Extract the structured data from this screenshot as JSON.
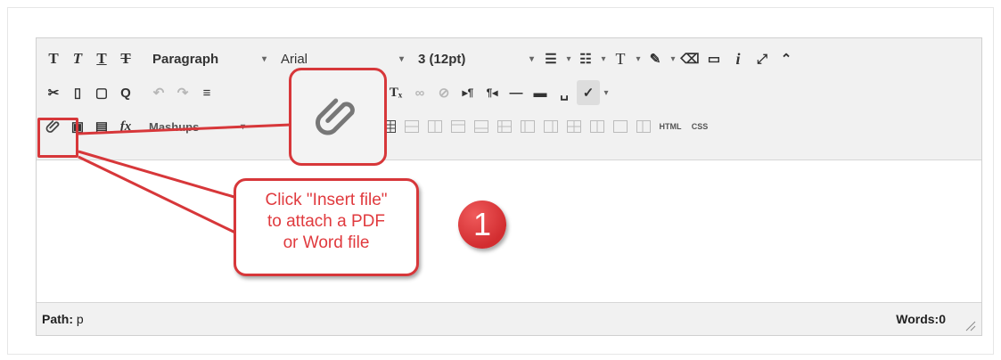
{
  "toolbar": {
    "format_select": "Paragraph",
    "font_select": "Arial",
    "size_select": "3 (12pt)",
    "html_label": "HTML",
    "css_label": "CSS",
    "mashups_label": "Mashups"
  },
  "status": {
    "path_label": "Path:",
    "path_value": "p",
    "words_label": "Words:0"
  },
  "annotation": {
    "callout_line1": "Click \"Insert file\"",
    "callout_line2": "to attach a PDF",
    "callout_line3": "or Word file",
    "step_number": "1",
    "accent_color": "#d7373a"
  }
}
